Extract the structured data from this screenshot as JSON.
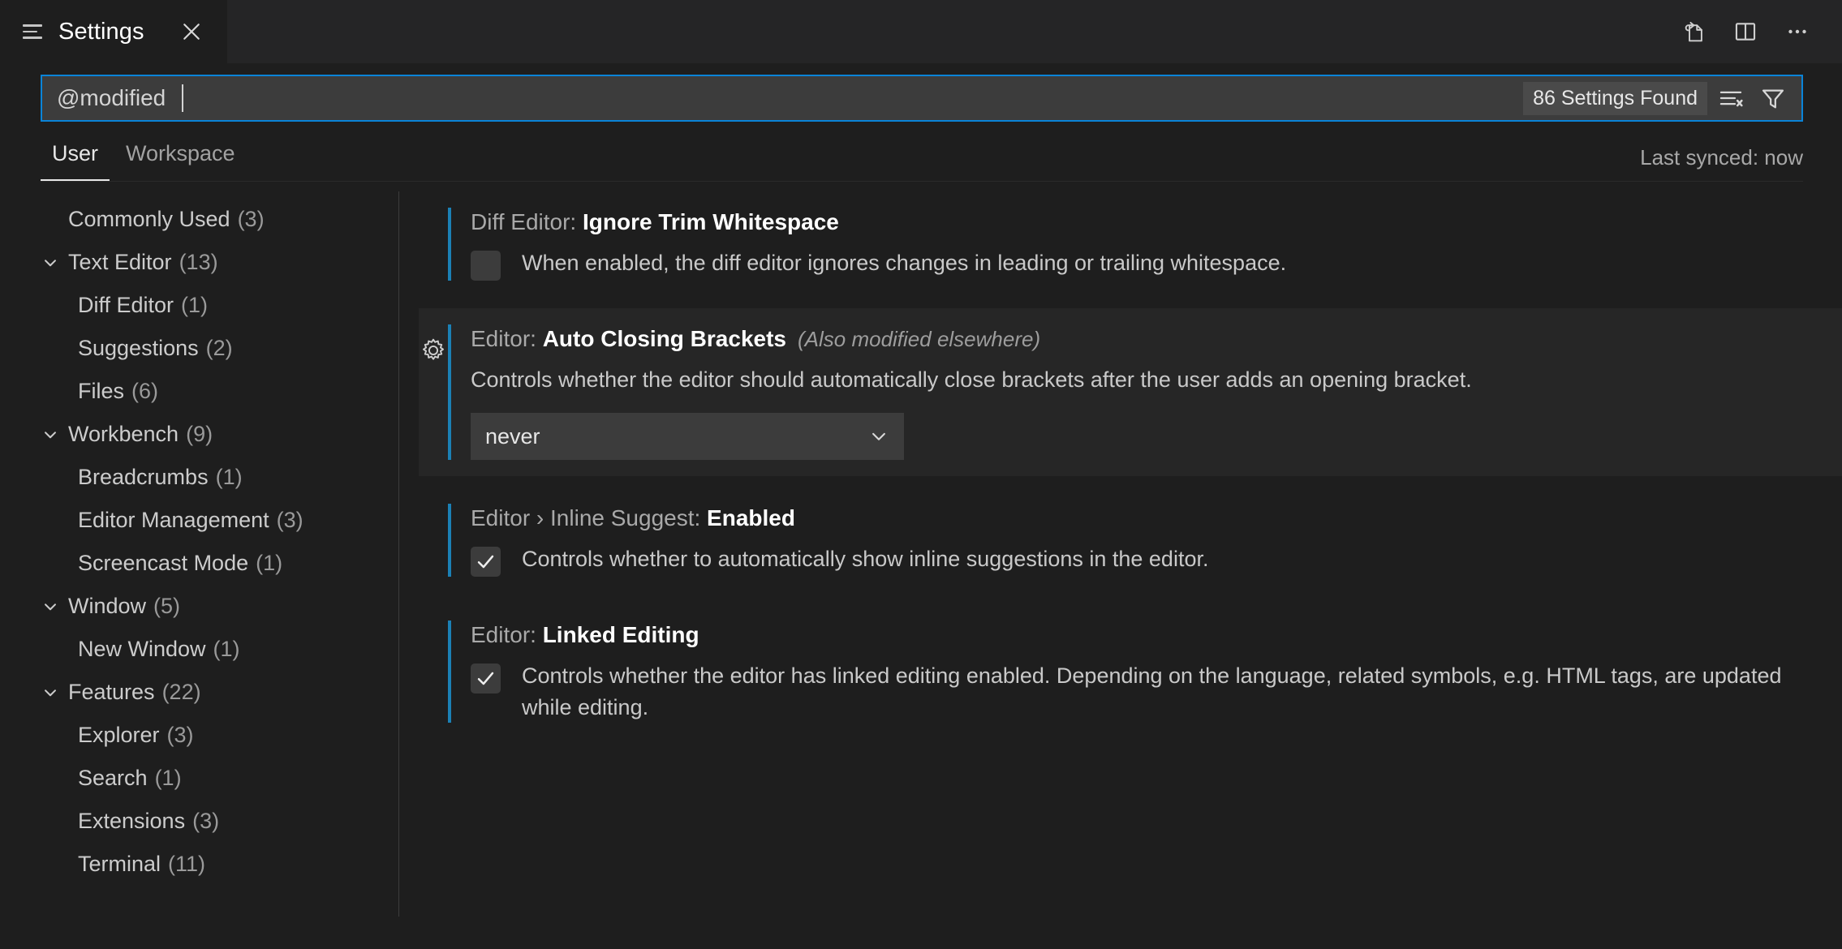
{
  "window": {
    "tab": {
      "icon": "settings-lines-icon",
      "title": "Settings",
      "close_label": "×"
    },
    "actions": [
      {
        "name": "open-settings-json-icon",
        "tooltip": "Open Settings (JSON)"
      },
      {
        "name": "split-editor-icon",
        "tooltip": "Split Editor"
      },
      {
        "name": "more-actions-icon",
        "tooltip": "More Actions..."
      }
    ]
  },
  "search": {
    "value": "@modified ",
    "placeholder": "Search settings",
    "results_label": "86 Settings Found",
    "clear_filter_icon": "clear-search-results-icon",
    "filter_icon": "filter-funnel-icon"
  },
  "scope": {
    "tabs": [
      {
        "label": "User",
        "active": true
      },
      {
        "label": "Workspace",
        "active": false
      }
    ],
    "sync_status": "Last synced: now"
  },
  "toc": {
    "items": [
      {
        "label": "Commonly Used",
        "count": "(3)",
        "level": "root",
        "chevron": false
      },
      {
        "label": "Text Editor",
        "count": "(13)",
        "level": "root",
        "chevron": true
      },
      {
        "label": "Diff Editor",
        "count": "(1)",
        "level": "child",
        "chevron": false
      },
      {
        "label": "Suggestions",
        "count": "(2)",
        "level": "child",
        "chevron": false
      },
      {
        "label": "Files",
        "count": "(6)",
        "level": "child",
        "chevron": false
      },
      {
        "label": "Workbench",
        "count": "(9)",
        "level": "root",
        "chevron": true
      },
      {
        "label": "Breadcrumbs",
        "count": "(1)",
        "level": "child",
        "chevron": false
      },
      {
        "label": "Editor Management",
        "count": "(3)",
        "level": "child",
        "chevron": false
      },
      {
        "label": "Screencast Mode",
        "count": "(1)",
        "level": "child",
        "chevron": false
      },
      {
        "label": "Window",
        "count": "(5)",
        "level": "root",
        "chevron": true
      },
      {
        "label": "New Window",
        "count": "(1)",
        "level": "child",
        "chevron": false
      },
      {
        "label": "Features",
        "count": "(22)",
        "level": "root",
        "chevron": true
      },
      {
        "label": "Explorer",
        "count": "(3)",
        "level": "child",
        "chevron": false
      },
      {
        "label": "Search",
        "count": "(1)",
        "level": "child",
        "chevron": false
      },
      {
        "label": "Extensions",
        "count": "(3)",
        "level": "child",
        "chevron": false
      },
      {
        "label": "Terminal",
        "count": "(11)",
        "level": "child",
        "chevron": false
      }
    ]
  },
  "settings": [
    {
      "title_prefix": "Diff Editor: ",
      "title_name": "Ignore Trim Whitespace",
      "title_note": "",
      "description": "When enabled, the diff editor ignores changes in leading or trailing whitespace.",
      "control": "checkbox",
      "checked": false,
      "modified": true,
      "highlighted": false,
      "gear": false
    },
    {
      "title_prefix": "Editor: ",
      "title_name": "Auto Closing Brackets",
      "title_note": "(Also modified elsewhere)",
      "description": "Controls whether the editor should automatically close brackets after the user adds an opening bracket.",
      "control": "select",
      "select_value": "never",
      "modified": true,
      "highlighted": true,
      "gear": true
    },
    {
      "title_prefix": "Editor › Inline Suggest: ",
      "title_name": "Enabled",
      "title_note": "",
      "description": "Controls whether to automatically show inline suggestions in the editor.",
      "control": "checkbox",
      "checked": true,
      "modified": true,
      "highlighted": false,
      "gear": false
    },
    {
      "title_prefix": "Editor: ",
      "title_name": "Linked Editing",
      "title_note": "",
      "description": "Controls whether the editor has linked editing enabled. Depending on the language, related symbols, e.g. HTML tags, are updated while editing.",
      "control": "checkbox",
      "checked": true,
      "modified": true,
      "highlighted": false,
      "gear": false
    }
  ],
  "colors": {
    "background": "#1e1e1e",
    "tabbar_background": "#252526",
    "row_hover": "#262626",
    "modified_indicator": "#1b80b5",
    "focus_border": "#0a84d8",
    "input_background": "#3c3c3c",
    "text": "#cccccc",
    "text_bright": "#ffffff",
    "text_dim": "#9a9a9a"
  }
}
